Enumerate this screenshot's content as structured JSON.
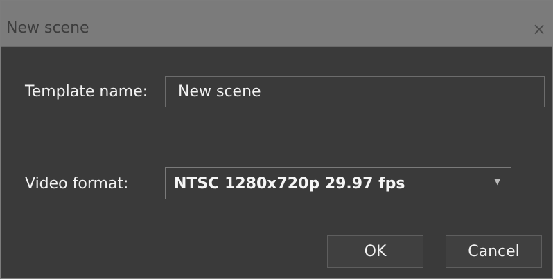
{
  "dialog": {
    "title": "New scene",
    "close_icon": "close-icon"
  },
  "form": {
    "template_name": {
      "label": "Template name:",
      "value": "New scene"
    },
    "video_format": {
      "label": "Video format:",
      "selected": "NTSC 1280x720p 29.97 fps",
      "dropdown_icon": "chevron-down-icon"
    }
  },
  "buttons": {
    "ok": "OK",
    "cancel": "Cancel"
  },
  "colors": {
    "titlebar": "#7b7b7b",
    "background": "#3a3a3a",
    "text": "#f2f2f2"
  }
}
